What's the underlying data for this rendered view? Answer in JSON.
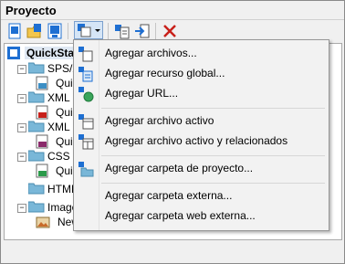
{
  "window": {
    "title": "Proyecto"
  },
  "tree": {
    "root_label": "QuickStart",
    "items": [
      {
        "label": "SPS/XSLT"
      },
      {
        "label": "Quic"
      },
      {
        "label": "XML F"
      },
      {
        "label": "Quic"
      },
      {
        "label": "XML S"
      },
      {
        "label": "Quic"
      },
      {
        "label": "CSS F"
      },
      {
        "label": "Quic"
      },
      {
        "label": "HTML"
      },
      {
        "label": "Image"
      },
      {
        "label": "New"
      }
    ]
  },
  "menu": {
    "items": [
      {
        "label": "Agregar archivos..."
      },
      {
        "label": "Agregar recurso global..."
      },
      {
        "label": "Agregar URL..."
      },
      {
        "label": "Agregar archivo activo"
      },
      {
        "label": "Agregar archivo activo y relacionados"
      },
      {
        "label": "Agregar carpeta de proyecto..."
      },
      {
        "label": "Agregar carpeta externa..."
      },
      {
        "label": "Agregar carpeta web externa..."
      }
    ]
  },
  "colors": {
    "accent": "#1e6fd2",
    "folder": "#79b7d8",
    "delete": "#c8201a"
  }
}
